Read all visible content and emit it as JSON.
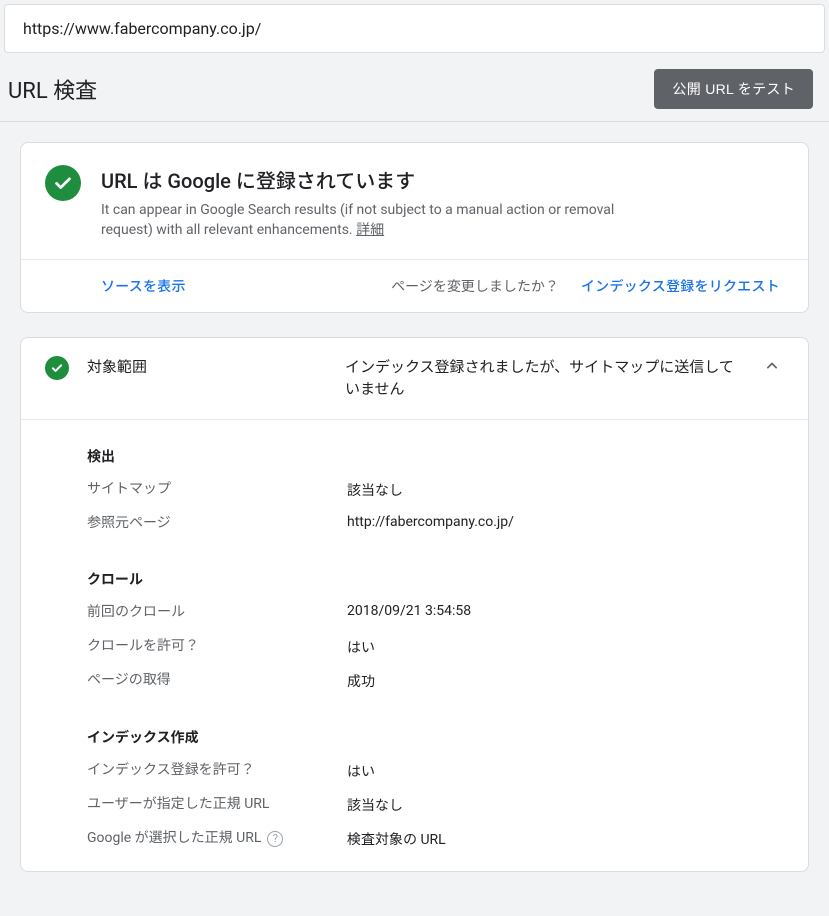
{
  "url_bar": "https://www.fabercompany.co.jp/",
  "header": {
    "title": "URL 検査",
    "test_button": "公開 URL をテスト"
  },
  "status": {
    "title": "URL は Google に登録されています",
    "description": "It can appear in Google Search results (if not subject to a manual action or removal request) with all relevant enhancements. ",
    "details_link": "詳細"
  },
  "actions": {
    "view_source": "ソースを表示",
    "page_changed": "ページを変更しましたか？",
    "request_indexing": "インデックス登録をリクエスト"
  },
  "coverage": {
    "label": "対象範囲",
    "summary": "インデックス登録されましたが、サイトマップに送信していません",
    "groups": {
      "discovery": {
        "title": "検出",
        "sitemap_label": "サイトマップ",
        "sitemap_value": "該当なし",
        "referrer_label": "参照元ページ",
        "referrer_value": "http://fabercompany.co.jp/"
      },
      "crawl": {
        "title": "クロール",
        "last_crawl_label": "前回のクロール",
        "last_crawl_value": "2018/09/21 3:54:58",
        "crawl_allowed_label": "クロールを許可？",
        "crawl_allowed_value": "はい",
        "fetch_label": "ページの取得",
        "fetch_value": "成功"
      },
      "indexing": {
        "title": "インデックス作成",
        "indexing_allowed_label": "インデックス登録を許可？",
        "indexing_allowed_value": "はい",
        "user_canonical_label": "ユーザーが指定した正規 URL",
        "user_canonical_value": "該当なし",
        "google_canonical_label": "Google が選択した正規 URL",
        "google_canonical_value": "検査対象の URL"
      }
    }
  }
}
